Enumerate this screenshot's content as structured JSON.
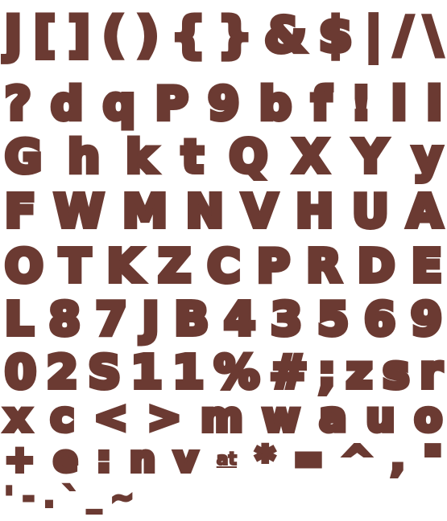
{
  "rows": [
    [
      "j",
      "[",
      "]",
      "(",
      ")",
      "{",
      "}",
      "&",
      "$",
      "|",
      "/",
      "\\"
    ],
    [
      "?",
      "d",
      "q",
      "P",
      "9",
      "b",
      "f",
      "!",
      "l",
      "i"
    ],
    [
      "G",
      "h",
      "k",
      "t",
      "Q",
      "X",
      "Y",
      "y"
    ],
    [
      "F",
      "W",
      "M",
      "N",
      "V",
      "H",
      "U",
      "A"
    ],
    [
      "O",
      "T",
      "K",
      "Z",
      "C",
      "P",
      "R",
      "D",
      "E"
    ],
    [
      "L",
      "8",
      "7",
      "J",
      "B",
      "4",
      "3",
      "5",
      "6",
      "9"
    ],
    [
      "0",
      "2",
      "S",
      "1",
      "1",
      "%",
      "#",
      ";",
      "z",
      "s",
      "r"
    ],
    [
      "x",
      "c",
      "<",
      ">",
      "m",
      "w",
      "a",
      "u",
      "o"
    ],
    [
      "+",
      "e",
      ":",
      "n",
      "v",
      "at",
      "*",
      "=",
      "^",
      ",",
      "\""
    ],
    [
      "'",
      "-",
      ".",
      "`",
      "_",
      "~"
    ]
  ],
  "colors": {
    "glyph": "#6b3a32",
    "background": "#ffffff"
  }
}
